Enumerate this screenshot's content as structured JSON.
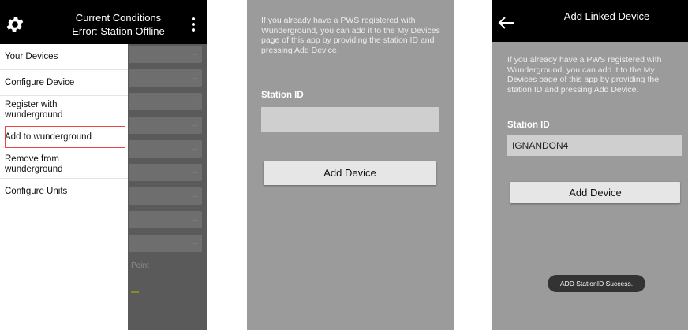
{
  "screen1": {
    "header": {
      "title_line1": "Current Conditions",
      "title_line2": "Error: Station Offline"
    },
    "menu": [
      "Your Devices",
      "Configure Device",
      "Register with wunderground",
      "Add to wunderground",
      "Remove from wunderground",
      "Configure Units"
    ],
    "highlighted_item": "Add to wunderground",
    "background_rows": [
      "--",
      "--",
      "--",
      "--",
      "--",
      "--",
      "--",
      "--",
      "--"
    ],
    "background_label": "Point"
  },
  "screen2": {
    "intro": "If you already have a PWS registered with Wunderground, you can add it to the My Devices page of this app by providing the station ID and pressing Add Device.",
    "station_label": "Station ID",
    "station_value": "",
    "button": "Add Device"
  },
  "screen3": {
    "header": {
      "title": "Add Linked Device"
    },
    "intro": "If you already have a PWS registered with Wunderground, you can add it to the My Devices page of this app by providing the station ID and pressing Add Device.",
    "station_label": "Station ID",
    "station_value": "IGNANDON4",
    "button": "Add Device",
    "toast": "ADD StationID Success."
  },
  "colors": {
    "header_bg": "#000000",
    "panel_bg": "#9b9b9b",
    "highlight_border": "#e44444"
  }
}
